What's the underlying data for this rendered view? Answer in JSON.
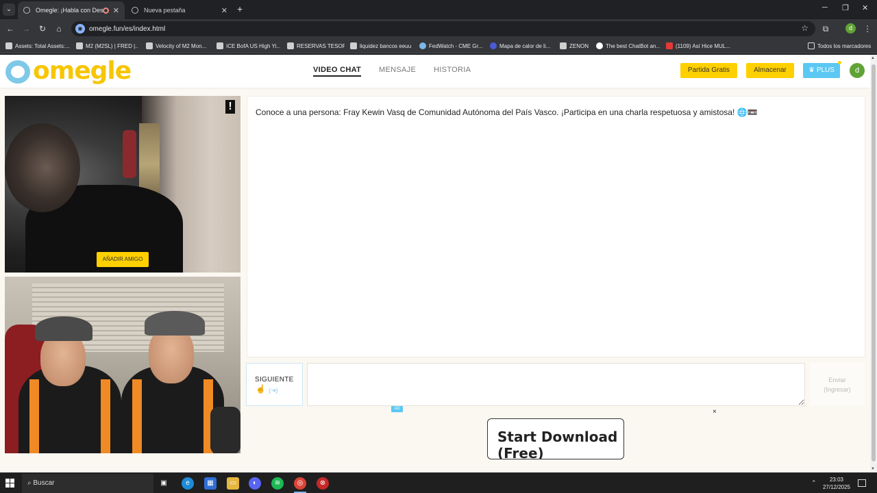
{
  "browser": {
    "tabs": [
      {
        "label": "Omegle: ¡Habla con Descon",
        "active": true
      },
      {
        "label": "Nueva pestaña",
        "active": false
      }
    ],
    "url": "omegle.fun/es/index.html",
    "bookmarks": [
      "Assets: Total Assets:...",
      "M2 (M2SL) | FRED |...",
      "Velocity of M2 Mon...",
      "ICE BofA US High Yi...",
      "RESERVAS TESORO",
      "liquidez bancos eeuu",
      "FedWatch - CME Gr...",
      "Mapa de calor de li...",
      "ZENON",
      "The best ChatBot an...",
      "(1109) Así Hice MUL...",
      "Todos los marcadores"
    ],
    "profile_initial": "d"
  },
  "site": {
    "logo_text": "omegle",
    "nav": [
      {
        "label": "VIDEO CHAT",
        "active": true
      },
      {
        "label": "MENSAJE",
        "active": false
      },
      {
        "label": "HISTORIA",
        "active": false
      }
    ],
    "buttons": {
      "free_match": "Partida Gratis",
      "store": "Almacenar",
      "plus": "PLUS"
    },
    "user_initial": "d",
    "colors": {
      "brand_yellow": "#ffd000",
      "brand_blue": "#5bc8f3"
    }
  },
  "video": {
    "report_label": "!",
    "add_friend": "AÑADIR AMIGO"
  },
  "chat": {
    "intro_message": "Conoce a una persona: Fray Kewin Vasq de Comunidad Autónoma del País Vasco. ¡Participa en una charla respetuosa y amistosa! 🌐📼",
    "next_label": "SIGUIENTE",
    "next_hint": "(⇥)",
    "input_value": "",
    "send_label": "Enviar",
    "send_hint": "(Ingresar)"
  },
  "ad": {
    "badge": "AD",
    "close": "×",
    "cta": "Start Download (Free)"
  },
  "taskbar": {
    "search_placeholder": "Buscar",
    "time": "23:03",
    "date": "27/12/2025"
  }
}
